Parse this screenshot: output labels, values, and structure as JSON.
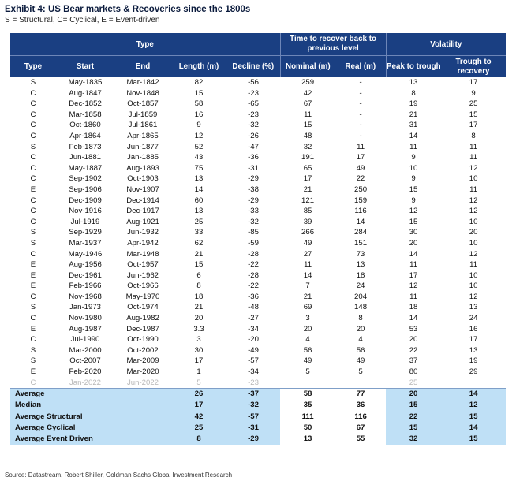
{
  "title": "Exhibit 4: US Bear markets & Recoveries since the 1800s",
  "subtitle": "S = Structural, C= Cyclical, E = Event-driven",
  "header": {
    "group_type": "Type",
    "group_recover": "Time to recover back to previous level",
    "group_volatility": "Volatility",
    "col_type": "Type",
    "col_start": "Start",
    "col_end": "End",
    "col_length": "Length (m)",
    "col_decline": "Decline (%)",
    "col_nominal": "Nominal (m)",
    "col_real": "Real (m)",
    "col_peak": "Peak to trough",
    "col_trough": "Trough to recovery"
  },
  "rows": [
    [
      "S",
      "May-1835",
      "Mar-1842",
      "82",
      "-56",
      "259",
      "-",
      "13",
      "17"
    ],
    [
      "C",
      "Aug-1847",
      "Nov-1848",
      "15",
      "-23",
      "42",
      "-",
      "8",
      "9"
    ],
    [
      "C",
      "Dec-1852",
      "Oct-1857",
      "58",
      "-65",
      "67",
      "-",
      "19",
      "25"
    ],
    [
      "C",
      "Mar-1858",
      "Jul-1859",
      "16",
      "-23",
      "11",
      "-",
      "21",
      "15"
    ],
    [
      "C",
      "Oct-1860",
      "Jul-1861",
      "9",
      "-32",
      "15",
      "-",
      "31",
      "17"
    ],
    [
      "C",
      "Apr-1864",
      "Apr-1865",
      "12",
      "-26",
      "48",
      "-",
      "14",
      "8"
    ],
    [
      "S",
      "Feb-1873",
      "Jun-1877",
      "52",
      "-47",
      "32",
      "11",
      "11",
      "11"
    ],
    [
      "C",
      "Jun-1881",
      "Jan-1885",
      "43",
      "-36",
      "191",
      "17",
      "9",
      "11"
    ],
    [
      "C",
      "May-1887",
      "Aug-1893",
      "75",
      "-31",
      "65",
      "49",
      "10",
      "12"
    ],
    [
      "C",
      "Sep-1902",
      "Oct-1903",
      "13",
      "-29",
      "17",
      "22",
      "9",
      "10"
    ],
    [
      "E",
      "Sep-1906",
      "Nov-1907",
      "14",
      "-38",
      "21",
      "250",
      "15",
      "11"
    ],
    [
      "C",
      "Dec-1909",
      "Dec-1914",
      "60",
      "-29",
      "121",
      "159",
      "9",
      "12"
    ],
    [
      "C",
      "Nov-1916",
      "Dec-1917",
      "13",
      "-33",
      "85",
      "116",
      "12",
      "12"
    ],
    [
      "C",
      "Jul-1919",
      "Aug-1921",
      "25",
      "-32",
      "39",
      "14",
      "15",
      "10"
    ],
    [
      "S",
      "Sep-1929",
      "Jun-1932",
      "33",
      "-85",
      "266",
      "284",
      "30",
      "20"
    ],
    [
      "S",
      "Mar-1937",
      "Apr-1942",
      "62",
      "-59",
      "49",
      "151",
      "20",
      "10"
    ],
    [
      "C",
      "May-1946",
      "Mar-1948",
      "21",
      "-28",
      "27",
      "73",
      "14",
      "12"
    ],
    [
      "E",
      "Aug-1956",
      "Oct-1957",
      "15",
      "-22",
      "11",
      "13",
      "11",
      "11"
    ],
    [
      "E",
      "Dec-1961",
      "Jun-1962",
      "6",
      "-28",
      "14",
      "18",
      "17",
      "10"
    ],
    [
      "E",
      "Feb-1966",
      "Oct-1966",
      "8",
      "-22",
      "7",
      "24",
      "12",
      "10"
    ],
    [
      "C",
      "Nov-1968",
      "May-1970",
      "18",
      "-36",
      "21",
      "204",
      "11",
      "12"
    ],
    [
      "S",
      "Jan-1973",
      "Oct-1974",
      "21",
      "-48",
      "69",
      "148",
      "18",
      "13"
    ],
    [
      "C",
      "Nov-1980",
      "Aug-1982",
      "20",
      "-27",
      "3",
      "8",
      "14",
      "24"
    ],
    [
      "E",
      "Aug-1987",
      "Dec-1987",
      "3.3",
      "-34",
      "20",
      "20",
      "53",
      "16"
    ],
    [
      "C",
      "Jul-1990",
      "Oct-1990",
      "3",
      "-20",
      "4",
      "4",
      "20",
      "17"
    ],
    [
      "S",
      "Mar-2000",
      "Oct-2002",
      "30",
      "-49",
      "56",
      "56",
      "22",
      "13"
    ],
    [
      "S",
      "Oct-2007",
      "Mar-2009",
      "17",
      "-57",
      "49",
      "49",
      "37",
      "19"
    ],
    [
      "E",
      "Feb-2020",
      "Mar-2020",
      "1",
      "-34",
      "5",
      "5",
      "80",
      "29"
    ],
    [
      "C",
      "Jan-2022",
      "Jun-2022",
      "5",
      "-23",
      "",
      "",
      "25",
      ""
    ]
  ],
  "faded_row_index": 28,
  "stats": [
    {
      "label": "Average",
      "length": "26",
      "decline": "-37",
      "nominal": "58",
      "real": "77",
      "peak": "20",
      "trough": "14"
    },
    {
      "label": "Median",
      "length": "17",
      "decline": "-32",
      "nominal": "35",
      "real": "36",
      "peak": "15",
      "trough": "12"
    },
    {
      "label": "Average Structural",
      "length": "42",
      "decline": "-57",
      "nominal": "111",
      "real": "116",
      "peak": "22",
      "trough": "15"
    },
    {
      "label": "Average Cyclical",
      "length": "25",
      "decline": "-31",
      "nominal": "50",
      "real": "67",
      "peak": "15",
      "trough": "14"
    },
    {
      "label": "Average Event Driven",
      "length": "8",
      "decline": "-29",
      "nominal": "13",
      "real": "55",
      "peak": "32",
      "trough": "15"
    }
  ],
  "footer": "Source: Datastream, Robert Shiller, Goldman Sachs Global Investment Research"
}
